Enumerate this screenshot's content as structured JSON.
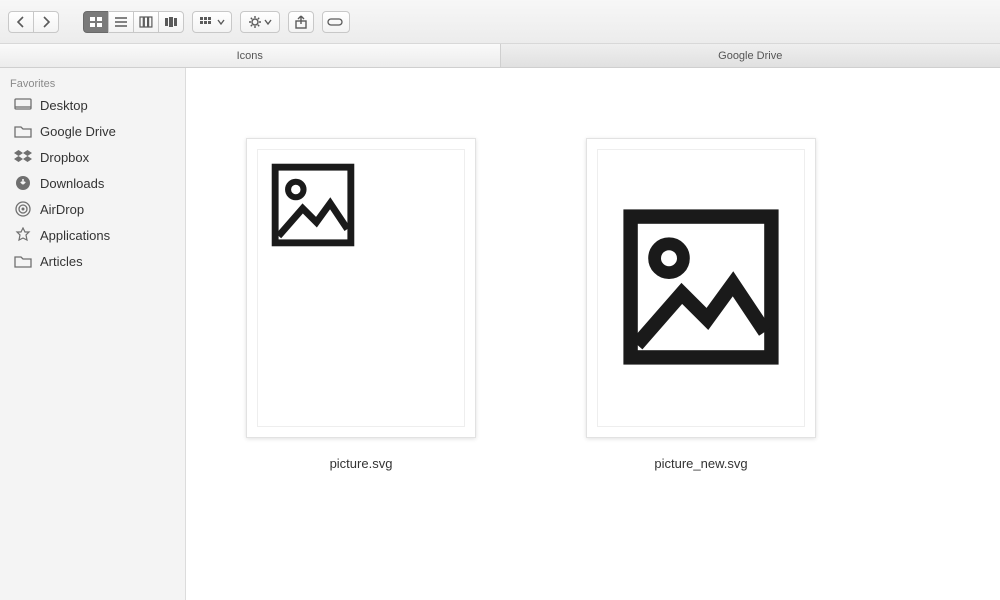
{
  "pathbar": {
    "current": "Icons",
    "parent": "Google Drive"
  },
  "sidebar": {
    "header": "Favorites",
    "items": [
      {
        "label": "Desktop",
        "icon": "desktop-icon"
      },
      {
        "label": "Google Drive",
        "icon": "folder-icon"
      },
      {
        "label": "Dropbox",
        "icon": "dropbox-icon"
      },
      {
        "label": "Downloads",
        "icon": "downloads-icon"
      },
      {
        "label": "AirDrop",
        "icon": "airdrop-icon"
      },
      {
        "label": "Applications",
        "icon": "applications-icon"
      },
      {
        "label": "Articles",
        "icon": "folder-icon"
      }
    ]
  },
  "files": [
    {
      "name": "picture.svg"
    },
    {
      "name": "picture_new.svg"
    }
  ]
}
